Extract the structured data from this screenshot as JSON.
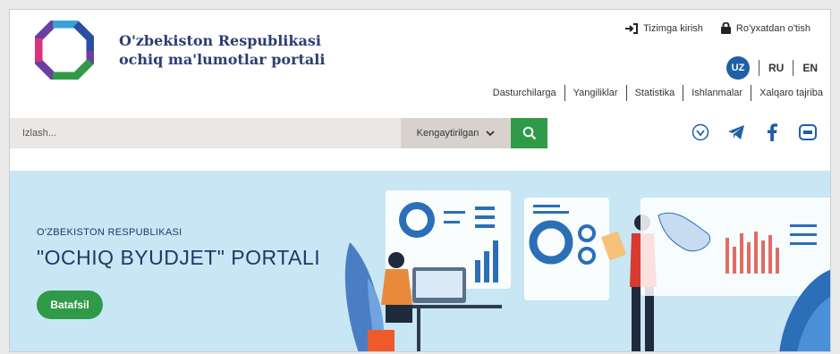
{
  "header": {
    "brand_line1": "O'zbekiston Respublikasi",
    "brand_line2": "ochiq ma'lumotlar portali",
    "login": "Tizimga kirish",
    "register": "Ro'yxatdan o'tish",
    "langs": {
      "uz": "UZ",
      "ru": "RU",
      "en": "EN"
    },
    "nav": [
      "Dasturchilarga",
      "Yangiliklar",
      "Statistika",
      "Ishlanmalar",
      "Xalqaro tajriba"
    ]
  },
  "search": {
    "placeholder": "Izlash...",
    "advanced_label": "Kengaytirilgan"
  },
  "banner": {
    "subtitle": "O'ZBEKISTON RESPUBLIKASI",
    "title": "\"OCHIQ BYUDJET\" PORTALI",
    "button": "Batafsil"
  },
  "colors": {
    "brand": "#2c3e73",
    "accent_green": "#2f9a47",
    "lang_active": "#1f5fa8",
    "banner_bg": "#c9e6f5"
  },
  "icons": [
    "login-icon",
    "lock-icon",
    "search-icon",
    "chevron-down-icon",
    "download-icon",
    "telegram-icon",
    "facebook-icon",
    "mail-icon"
  ]
}
